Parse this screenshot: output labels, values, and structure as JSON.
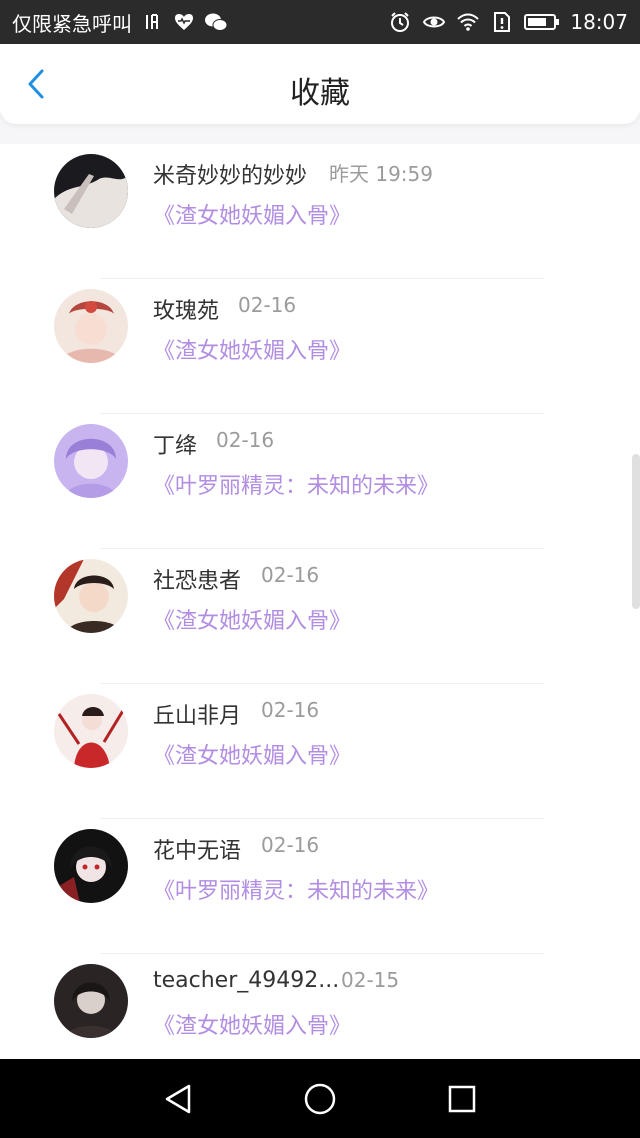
{
  "status_bar": {
    "left_text": "仅限紧急呼叫",
    "left_icons": [
      "earpiece-icon",
      "heart-icon",
      "wechat-icon"
    ],
    "right_icons": [
      "alarm-icon",
      "eye-icon",
      "wifi-icon",
      "sim-alert-icon",
      "battery-icon"
    ],
    "time": "18:07"
  },
  "header": {
    "title": "收藏",
    "back_icon": "chevron-left-icon",
    "accent_color": "#1e8fe1"
  },
  "list": {
    "items": [
      {
        "name": "米奇妙妙的妙妙",
        "time": "昨天 19:59",
        "book": "《渣女她妖媚入骨》"
      },
      {
        "name": "玫瑰苑",
        "time": "02-16",
        "book": "《渣女她妖媚入骨》"
      },
      {
        "name": "丁绛",
        "time": "02-16",
        "book": "《叶罗丽精灵：未知的未来》"
      },
      {
        "name": "社恐患者",
        "time": "02-16",
        "book": "《渣女她妖媚入骨》"
      },
      {
        "name": "丘山非月",
        "time": "02-16",
        "book": "《渣女她妖媚入骨》"
      },
      {
        "name": "花中无语",
        "time": "02-16",
        "book": "《叶罗丽精灵：未知的未来》"
      },
      {
        "name": "teacher_49492...",
        "time": "02-15",
        "book": "《渣女她妖媚入骨》"
      }
    ],
    "book_color": "#b28ee2"
  },
  "nav_bar": {
    "back_icon": "triangle-back-icon",
    "home_icon": "circle-home-icon",
    "recents_icon": "square-recents-icon"
  }
}
